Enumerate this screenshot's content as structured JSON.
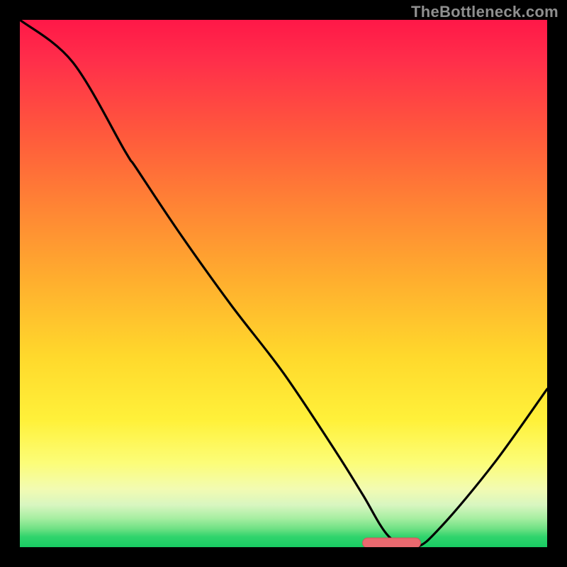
{
  "watermark": "TheBottleneck.com",
  "colors": {
    "frame": "#000000",
    "curve": "#000000",
    "bar_fill": "#e9696f",
    "bar_stroke": "#cf555c"
  },
  "chart_data": {
    "type": "line",
    "title": "",
    "xlabel": "",
    "ylabel": "",
    "xlim": [
      0,
      100
    ],
    "ylim": [
      0,
      100
    ],
    "x": [
      0,
      10,
      20,
      22,
      30,
      40,
      50,
      60,
      65,
      70,
      75,
      80,
      90,
      100
    ],
    "bottleneck": [
      100,
      92,
      75,
      72,
      60,
      46,
      33,
      18,
      10,
      2,
      0,
      4,
      16,
      30
    ],
    "optimal_band": {
      "x_start": 65,
      "x_end": 76,
      "y": 0
    },
    "notes": "V-shaped bottleneck curve; optimum (0%) between x≈65–76; left arm starts near 100% and has a knee around x≈20; right arm rises to ~30% at x=100."
  }
}
